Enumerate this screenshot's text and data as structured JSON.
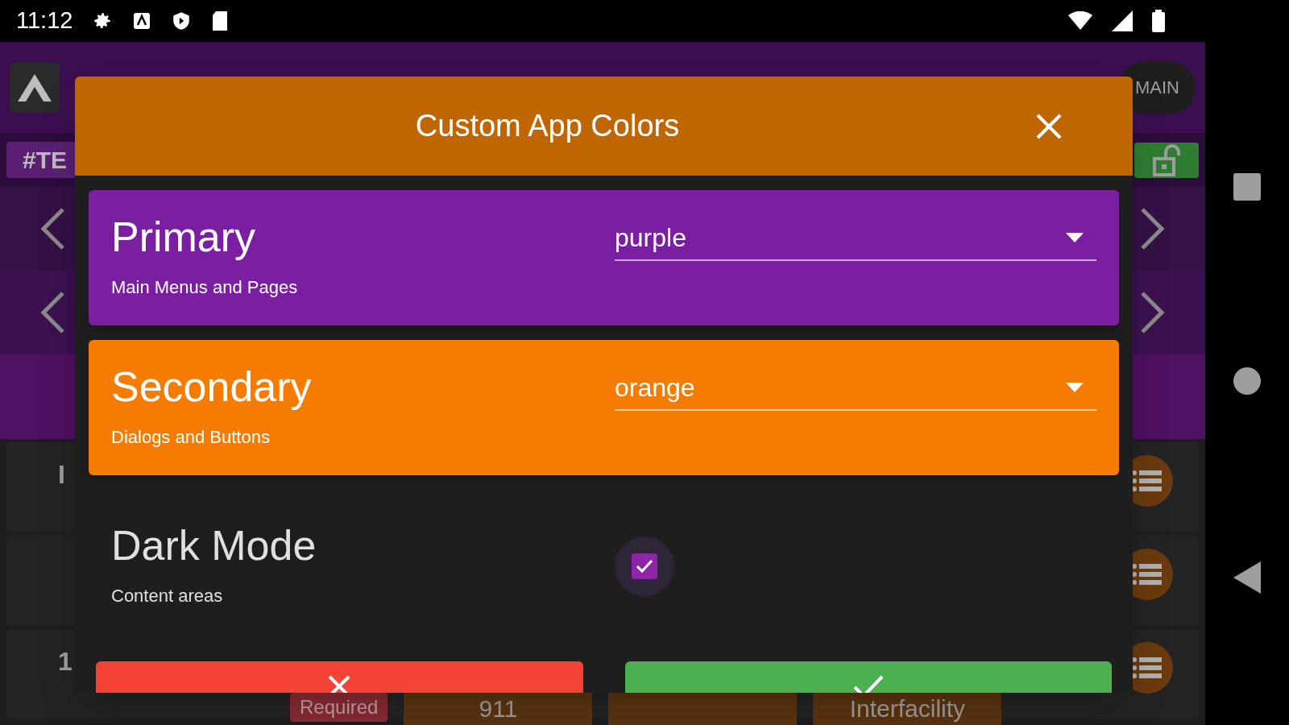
{
  "status_bar": {
    "time": "11:12"
  },
  "app": {
    "tag": "#TE",
    "main_button": "MAIN",
    "row_fragments": [
      {
        "kind": "labeled",
        "text": "I"
      },
      {
        "kind": "plain"
      },
      {
        "kind": "labeled",
        "text": "1"
      }
    ],
    "bottom_tags": [
      {
        "label": "Required",
        "kind": "required"
      },
      {
        "label": "911",
        "kind": "type"
      },
      {
        "kind": "type"
      },
      {
        "label": "Interfacility",
        "kind": "type"
      }
    ]
  },
  "dialog": {
    "title": "Custom App Colors",
    "colors": [
      {
        "label": "Primary",
        "description": "Main Menus and Pages",
        "value": "purple",
        "color": "#7b1fa2"
      },
      {
        "label": "Secondary",
        "description": "Dialogs and Buttons",
        "value": "orange",
        "color": "#f57c00"
      }
    ],
    "dark_mode": {
      "label": "Dark Mode",
      "description": "Content areas",
      "checked": true
    },
    "buttons": [
      {
        "kind": "cancel"
      },
      {
        "kind": "confirm"
      }
    ]
  }
}
